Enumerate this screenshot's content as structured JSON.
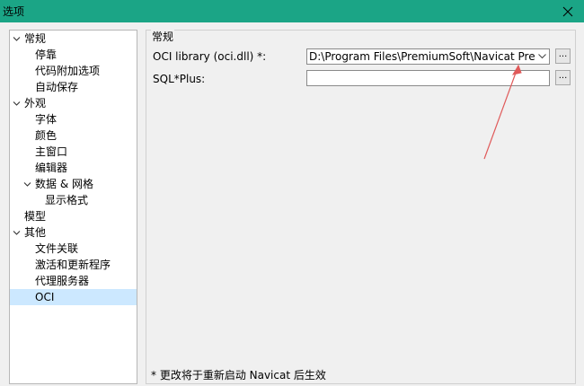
{
  "window": {
    "title": "选项"
  },
  "tree": [
    {
      "label": "常规",
      "level": 0,
      "expanded": true
    },
    {
      "label": "停靠",
      "level": 1
    },
    {
      "label": "代码附加选项",
      "level": 1
    },
    {
      "label": "自动保存",
      "level": 1
    },
    {
      "label": "外观",
      "level": 0,
      "expanded": true
    },
    {
      "label": "字体",
      "level": 1
    },
    {
      "label": "颜色",
      "level": 1
    },
    {
      "label": "主窗口",
      "level": 1
    },
    {
      "label": "编辑器",
      "level": 1
    },
    {
      "label": "数据 & 网格",
      "level": 1,
      "expanded": true
    },
    {
      "label": "显示格式",
      "level": 2
    },
    {
      "label": "模型",
      "level": 0
    },
    {
      "label": "其他",
      "level": 0,
      "expanded": true
    },
    {
      "label": "文件关联",
      "level": 1
    },
    {
      "label": "激活和更新程序",
      "level": 1
    },
    {
      "label": "代理服务器",
      "level": 1
    },
    {
      "label": "OCI",
      "level": 1,
      "selected": true
    }
  ],
  "panel": {
    "group_title": "常规",
    "oci": {
      "label": "OCI library (oci.dll) *:",
      "value": "D:\\Program Files\\PremiumSoft\\Navicat Premium",
      "browse_label": "..."
    },
    "sqlplus": {
      "label": "SQL*Plus:",
      "value": "",
      "browse_label": "..."
    },
    "note": "* 更改将于重新启动 Navicat 后生效"
  },
  "annotation": {
    "color": "#e05a5a"
  }
}
